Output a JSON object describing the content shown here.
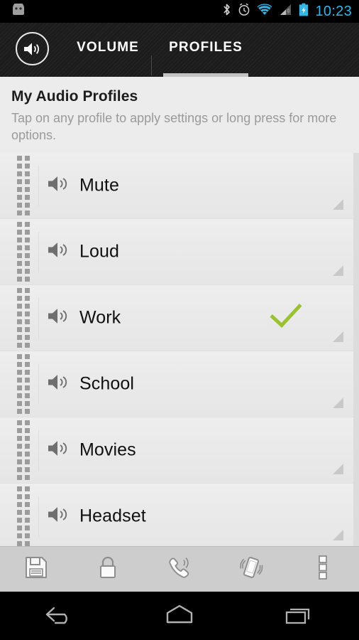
{
  "status_bar": {
    "time": "10:23",
    "icons": [
      "android-mascot-icon",
      "bluetooth-icon",
      "alarm-clock-icon",
      "wifi-icon",
      "cell-signal-icon",
      "battery-charging-icon"
    ],
    "time_color": "#33b5e5"
  },
  "action_bar": {
    "logo_icon": "app-speaker-logo-icon",
    "tabs": [
      {
        "label": "VOLUME",
        "selected": false
      },
      {
        "label": "PROFILES",
        "selected": true
      }
    ],
    "selected_underline_color": "#c4c4c4"
  },
  "page": {
    "title": "My Audio Profiles",
    "subtitle": "Tap on any profile to apply settings or long press for more options."
  },
  "profiles": [
    {
      "label": "Mute",
      "icon": "speaker-icon",
      "active": false
    },
    {
      "label": "Loud",
      "icon": "speaker-icon",
      "active": false
    },
    {
      "label": "Work",
      "icon": "speaker-icon",
      "active": true
    },
    {
      "label": "School",
      "icon": "speaker-icon",
      "active": false
    },
    {
      "label": "Movies",
      "icon": "speaker-icon",
      "active": false
    },
    {
      "label": "Headset",
      "icon": "speaker-icon",
      "active": false
    }
  ],
  "active_check_color": "#99c231",
  "bottom_toolbar": {
    "buttons": [
      {
        "name": "save-button",
        "icon": "floppy-disk-icon"
      },
      {
        "name": "lock-button",
        "icon": "lock-icon"
      },
      {
        "name": "ringer-button",
        "icon": "phone-ring-icon"
      },
      {
        "name": "vibrate-button",
        "icon": "vibrate-phone-icon"
      },
      {
        "name": "overflow-button",
        "icon": "overflow-menu-icon"
      }
    ]
  },
  "nav_bar": {
    "buttons": [
      {
        "name": "back-button",
        "icon": "back-arrow-icon"
      },
      {
        "name": "home-button",
        "icon": "home-icon"
      },
      {
        "name": "recents-button",
        "icon": "recents-icon"
      }
    ]
  }
}
